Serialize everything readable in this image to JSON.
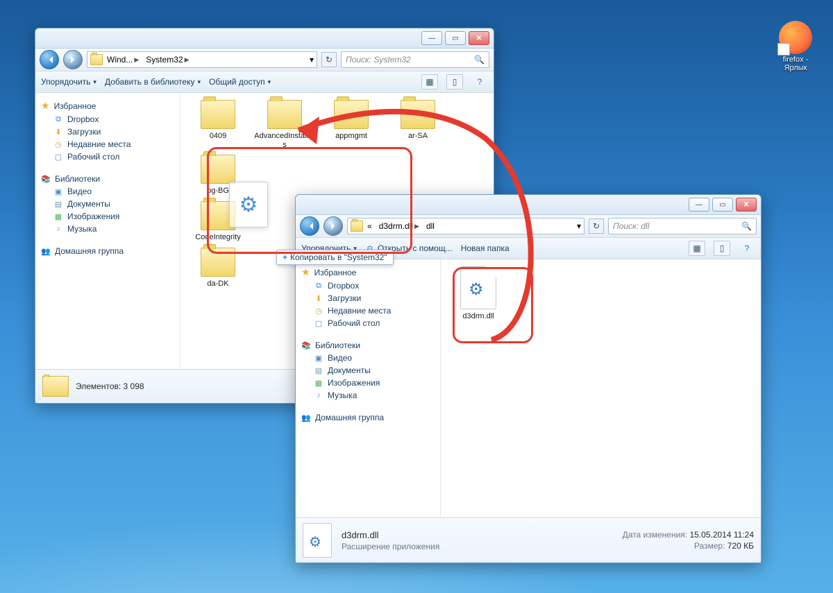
{
  "desktop": {
    "shortcut_label": "firefox - Ярлык"
  },
  "win1": {
    "crumbs": [
      "Wind...",
      "System32"
    ],
    "search_placeholder": "Поиск: System32",
    "toolbar": {
      "organize": "Упорядочить",
      "add_lib": "Добавить в библиотеку",
      "share": "Общий доступ"
    },
    "sidebar": {
      "fav": "Избранное",
      "dropbox": "Dropbox",
      "downloads": "Загрузки",
      "recent": "Недавние места",
      "desktop": "Рабочий стол",
      "libs": "Библиотеки",
      "video": "Видео",
      "docs": "Документы",
      "images": "Изображения",
      "music": "Музыка",
      "homegroup": "Домашняя группа"
    },
    "folders": [
      "0409",
      "AdvancedInstallers",
      "appmgmt",
      "ar-SA",
      "bg-BG",
      "CodeIntegrity",
      "da-DK"
    ],
    "status": "Элементов: 3 098",
    "copy_tip": "Копировать в \"System32\""
  },
  "win2": {
    "crumbs_prefix": "«",
    "crumbs": [
      "d3drm.dll",
      "dll"
    ],
    "search_placeholder": "Поиск: dll",
    "toolbar": {
      "organize": "Упорядочить",
      "open_with": "Открыть с помощ...",
      "new_folder": "Новая папка"
    },
    "sidebar": {
      "fav": "Избранное",
      "dropbox": "Dropbox",
      "downloads": "Загрузки",
      "recent": "Недавние места",
      "desktop": "Рабочий стол",
      "libs": "Библиотеки",
      "video": "Видео",
      "docs": "Документы",
      "images": "Изображения",
      "music": "Музыка",
      "homegroup": "Домашняя группа"
    },
    "file": "d3drm.dll",
    "details": {
      "name": "d3drm.dll",
      "type": "Расширение приложения",
      "mod_k": "Дата изменения:",
      "mod_v": "15.05.2014 11:24",
      "size_k": "Размер:",
      "size_v": "720 КБ"
    }
  }
}
